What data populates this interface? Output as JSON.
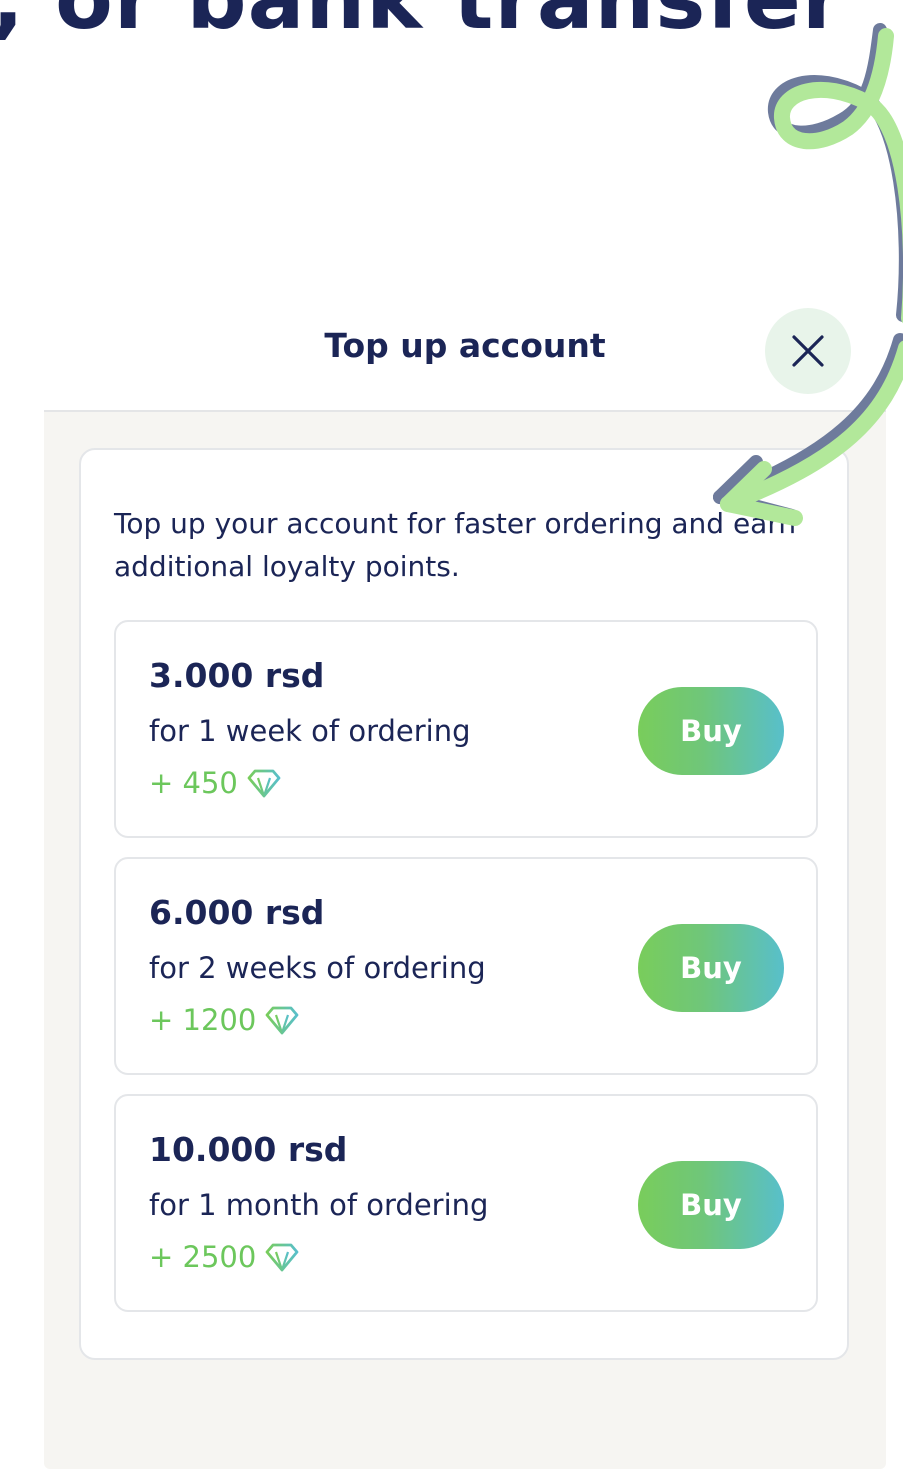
{
  "headline": ", or bank transfer",
  "sheet": {
    "title": "Top up account",
    "intro": "Top up your account for faster ordering and earn additional loyalty points."
  },
  "options": [
    {
      "amount": "3.000 rsd",
      "description": "for 1 week of ordering",
      "points": "+ 450",
      "buy_label": "Buy"
    },
    {
      "amount": "6.000 rsd",
      "description": "for 2 weeks of ordering",
      "points": "+ 1200",
      "buy_label": "Buy"
    },
    {
      "amount": "10.000 rsd",
      "description": "for 1 month of ordering",
      "points": "+ 2500",
      "buy_label": "Buy"
    }
  ],
  "icons": {
    "close": "close-icon",
    "points": "gem-icon"
  },
  "colors": {
    "navy": "#1b2556",
    "green": "#6cc75c",
    "teal": "#58bfcb",
    "close_bg": "#e8f4ea",
    "body_bg": "#f6f5f2"
  }
}
